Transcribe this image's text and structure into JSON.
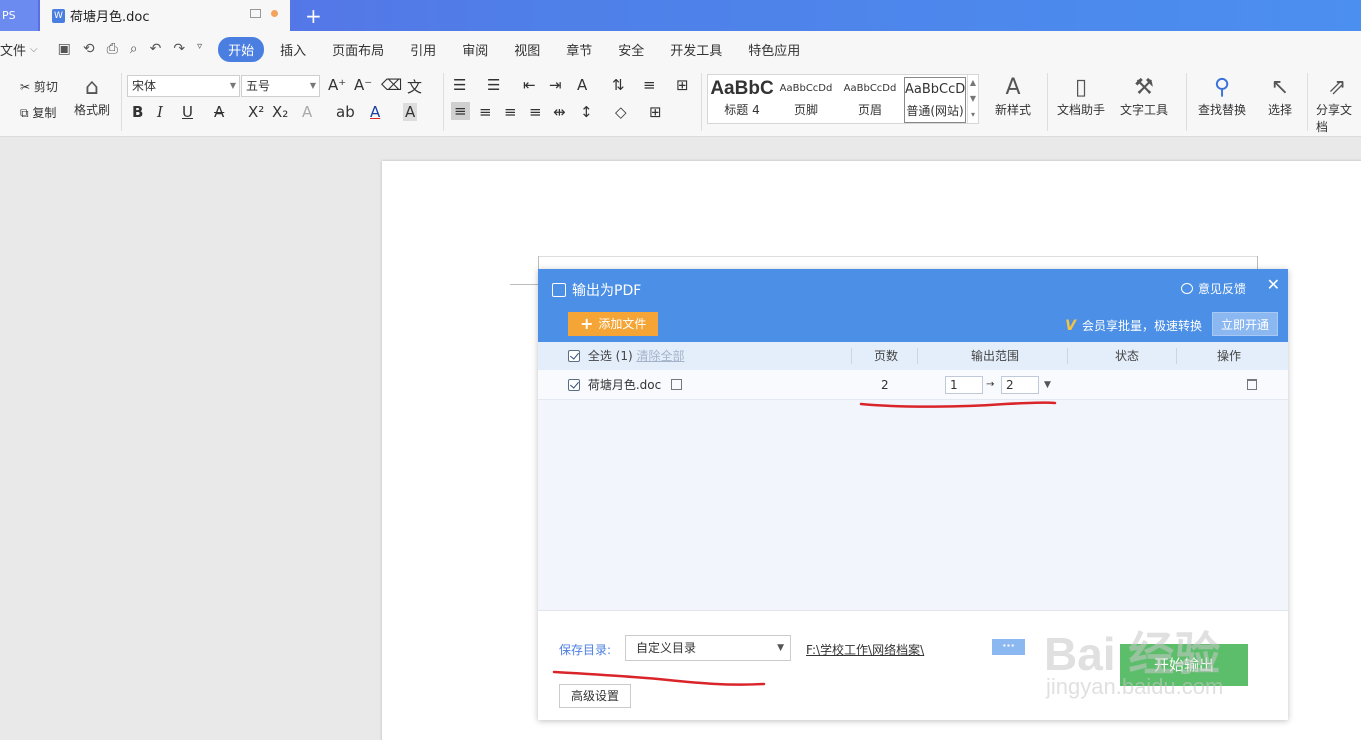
{
  "tabs": {
    "app_label": "PS",
    "doc_title": "荷塘月色.doc",
    "doc_icon_letter": "W",
    "new_tab": "+"
  },
  "menubar": {
    "file_label": "文件",
    "items": [
      "开始",
      "插入",
      "页面布局",
      "引用",
      "审阅",
      "视图",
      "章节",
      "安全",
      "开发工具",
      "特色应用"
    ]
  },
  "ribbon": {
    "cut": "剪切",
    "copy": "复制",
    "format_painter": "格式刷",
    "font_name": "宋体",
    "font_size": "五号",
    "styles": [
      {
        "sample": "AaBbC",
        "name": "标题 4"
      },
      {
        "sample": "AaBbCcDd",
        "name": "页脚"
      },
      {
        "sample": "AaBbCcDd",
        "name": "页眉"
      },
      {
        "sample": "AaBbCcD",
        "name": "普通(网站)"
      }
    ],
    "new_style": "新样式",
    "doc_assistant": "文档助手",
    "text_tools": "文字工具",
    "find_replace": "查找替换",
    "select": "选择",
    "share_doc": "分享文档"
  },
  "dialog": {
    "title": "输出为PDF",
    "feedback": "意见反馈",
    "add_file": "添加文件",
    "vip_text": "会员享批量，极速转换",
    "open_now": "立即开通",
    "columns": {
      "select_all": "全选 (1)",
      "clear_all": "清除全部",
      "pages": "页数",
      "range": "输出范围",
      "status": "状态",
      "action": "操作"
    },
    "files": [
      {
        "name": "荷塘月色.doc",
        "pages": "2",
        "range_from": "1",
        "range_to": "2"
      }
    ],
    "save_dir_label": "保存目录:",
    "save_dir_option": "自定义目录",
    "save_path": "F:\\学校工作\\网络档案\\",
    "more": "···",
    "start": "开始输出",
    "advanced": "高级设置"
  },
  "watermark": {
    "brand": "Bai 经验",
    "url": "jingyan.baidu.com"
  },
  "colors": {
    "dialog_header": "#4c8fe6",
    "add_button": "#f5a535",
    "start_button": "#5cbd6b",
    "annotation": "#d9252a"
  }
}
